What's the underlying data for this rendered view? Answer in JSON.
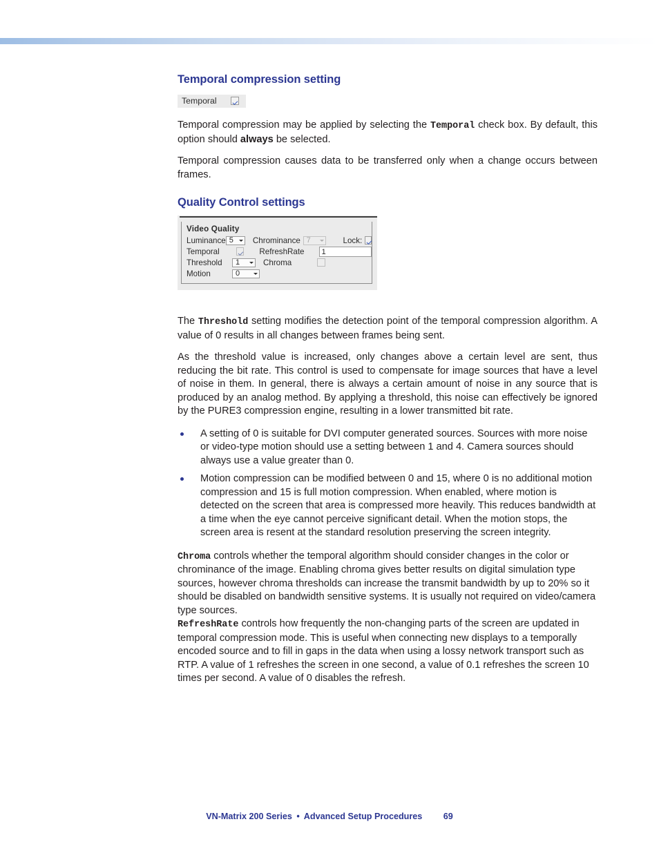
{
  "document": {
    "footer": {
      "title": "VN-Matrix 200 Series",
      "separator": "•",
      "chapter": "Advanced Setup Procedures",
      "page_number": "69"
    },
    "accent_color": "#2c3792",
    "text_color": "#231f20"
  },
  "sections": [
    {
      "heading": "Temporal compression setting"
    },
    {
      "heading": "Quality Control settings"
    }
  ],
  "temporal_widget": {
    "label": "Temporal",
    "checkbox_state": "checked"
  },
  "video_quality_panel": {
    "title": "Video Quality",
    "fields": {
      "luminance": {
        "label": "Luminance",
        "value": "5",
        "type": "dropdown",
        "enabled": true
      },
      "chrominance": {
        "label": "Chrominance",
        "value": "7",
        "type": "dropdown",
        "enabled": false
      },
      "lock": {
        "label": "Lock:",
        "value": "checked",
        "type": "checkbox",
        "enabled": true
      },
      "temporal": {
        "label": "Temporal",
        "value": "checked",
        "type": "checkbox",
        "enabled": false
      },
      "refresh_rate": {
        "label": "RefreshRate",
        "value": "1",
        "type": "text"
      },
      "threshold": {
        "label": "Threshold",
        "value": "1",
        "type": "dropdown",
        "enabled": true
      },
      "chroma": {
        "label": "Chroma",
        "value": "unchecked",
        "type": "checkbox",
        "enabled": false
      },
      "motion": {
        "label": "Motion",
        "value": "0",
        "type": "dropdown",
        "enabled": true
      }
    }
  },
  "paragraphs": {
    "temporal_1_a": "Temporal compression may be applied by selecting the ",
    "temporal_1_mono": "Temporal",
    "temporal_1_b": " check box. By default, this option should ",
    "temporal_1_bold": "always",
    "temporal_1_c": " be selected.",
    "temporal_2": "Temporal compression causes data to be transferred only when a change occurs between frames.",
    "threshold_a": "The ",
    "threshold_mono": "Threshold",
    "threshold_b": " setting modifies the detection point of the temporal compression algorithm. A value of 0 results in all changes between frames being sent.",
    "threshold_detail": "As the threshold value is increased, only changes above a certain level are sent, thus reducing the bit rate. This control is used to compensate for image sources that have a level of noise in them. In general, there is always a certain amount of noise in any source that is produced by an analog method. By applying a threshold, this noise can effectively be ignored by the PURE3 compression engine, resulting in a lower transmitted bit rate.",
    "chroma_mono": "Chroma",
    "chroma_body": " controls whether the temporal algorithm should consider changes in the color or chrominance of the image. Enabling chroma gives better results on digital simulation type sources, however chroma thresholds can increase the transmit bandwidth by up to 20% so it should be disabled on bandwidth sensitive systems. It is usually not required on video/camera type sources.",
    "refreshrate_mono": "RefreshRate",
    "refreshrate_body": " controls how frequently the non-changing parts of the screen are updated in temporal compression mode. This is useful when connecting new displays to a temporally encoded source and to fill in gaps in the data when using a lossy network transport such as RTP. A value of 1 refreshes the screen in one second, a value of 0.1 refreshes the screen 10 times per second. A value of 0 disables the refresh."
  },
  "bullets": [
    "A setting of 0 is suitable for DVI computer generated sources. Sources with more noise or video-type motion should use a setting between 1 and 4. Camera sources should always use a value greater than 0.",
    "Motion compression can be modified between 0 and 15, where 0 is no additional motion compression and 15 is full motion compression. When enabled, where motion is detected on the screen that area is compressed more heavily. This reduces bandwidth at a time when the eye cannot perceive significant detail. When the motion stops, the screen area is resent at the standard resolution preserving the screen integrity."
  ]
}
